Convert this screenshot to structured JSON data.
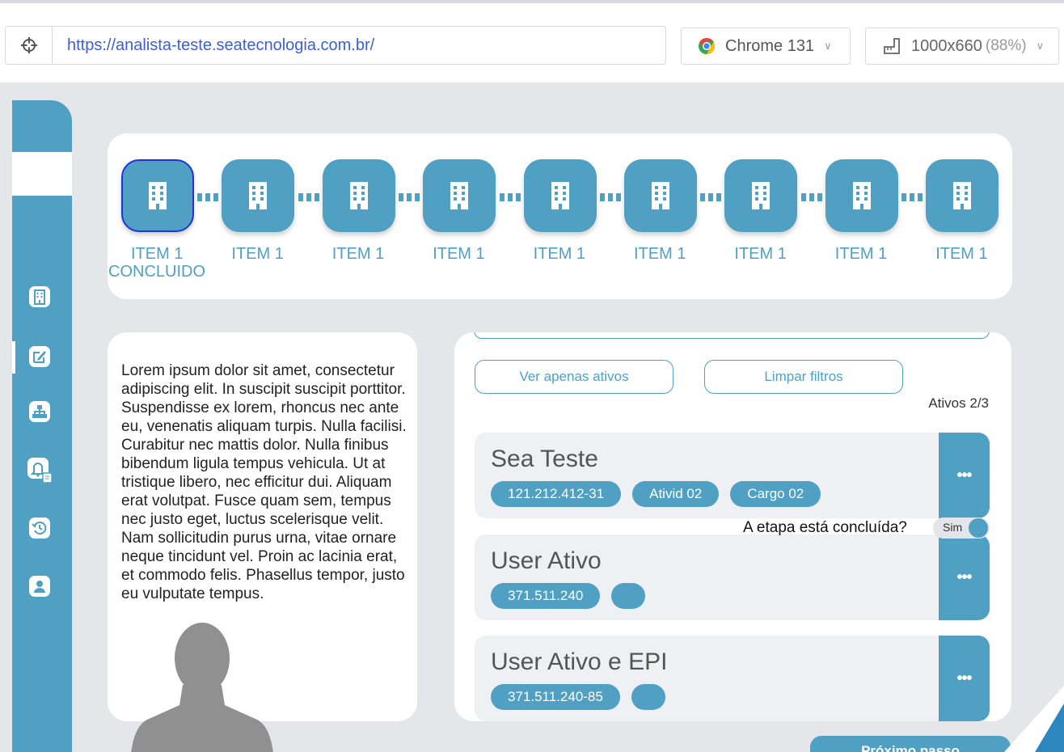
{
  "browser": {
    "url": "https://analista-teste.seatecnologia.com.br/",
    "browser_name": "Chrome 131",
    "resolution": "1000x660",
    "zoom": "(88%)",
    "chrome_icon_colors": [
      "#ea4335",
      "#fbbc05",
      "#34a853",
      "#4285f4"
    ]
  },
  "sidebar": {
    "items": [
      {
        "icon": "building-icon"
      },
      {
        "icon": "edit-icon",
        "active": true
      },
      {
        "icon": "org-chart-icon"
      },
      {
        "icon": "bell-document-icon"
      },
      {
        "icon": "history-icon"
      },
      {
        "icon": "user-icon"
      }
    ]
  },
  "steps": [
    {
      "label": "ITEM 1",
      "status": "CONCLUIDO",
      "active": true
    },
    {
      "label": "ITEM 1"
    },
    {
      "label": "ITEM 1"
    },
    {
      "label": "ITEM 1"
    },
    {
      "label": "ITEM 1"
    },
    {
      "label": "ITEM 1"
    },
    {
      "label": "ITEM 1"
    },
    {
      "label": "ITEM 1"
    },
    {
      "label": "ITEM 1"
    }
  ],
  "text_panel": {
    "body": "Lorem ipsum dolor sit amet, consectetur adipiscing elit. In suscipit suscipit porttitor. Suspendisse ex lorem, rhoncus nec ante eu, venenatis aliquam turpis. Nulla facilisi. Curabitur nec mattis dolor. Nulla finibus bibendum ligula tempus vehicula. Ut at tristique libero, nec efficitur dui. Aliquam erat volutpat. Fusce quam sem, tempus nec justo eget, luctus scelerisque velit. Nam sollicitudin purus urna, vitae ornare neque tincidunt vel. Proin ac lacinia erat, et commodo felis. Phasellus tempor, justo eu vulputate tempus."
  },
  "filters": {
    "active_only": "Ver apenas ativos",
    "clear": "Limpar filtros",
    "count": "Ativos 2/3"
  },
  "users": [
    {
      "name": "Sea Teste",
      "chips": [
        "121.212.412-31",
        "Ativid 02",
        "Cargo 02"
      ],
      "more": "•••"
    },
    {
      "name": "User Ativo",
      "chips": [
        "371.511.240",
        ""
      ],
      "more": "•••"
    },
    {
      "name": "User Ativo e EPI",
      "chips": [
        "371.511.240-85",
        ""
      ],
      "more": "•••"
    }
  ],
  "etapa": {
    "question": "A etapa está concluída?",
    "toggle_label": "Sim",
    "checked": true
  },
  "next_button": "Próximo passo",
  "colors": {
    "primary": "#4fa0c3",
    "background": "#e4e6ea",
    "active_border": "#2233dd"
  }
}
